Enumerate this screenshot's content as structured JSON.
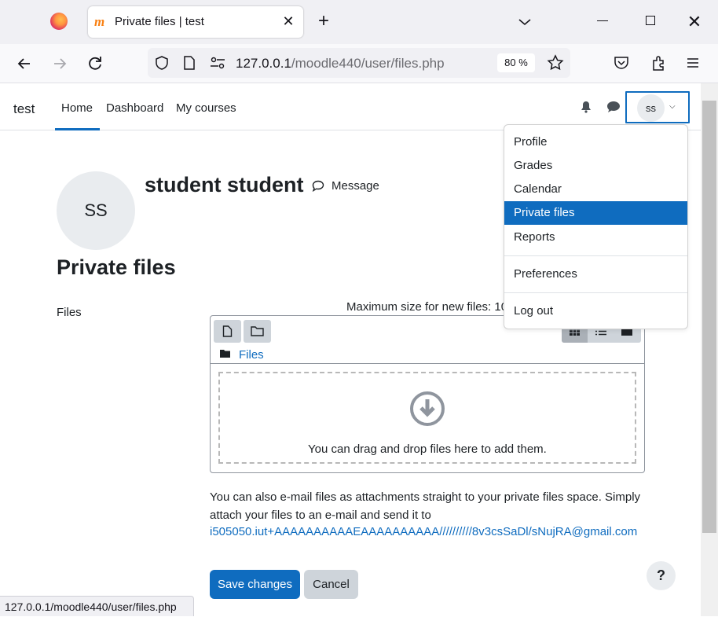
{
  "browser": {
    "tab_title": "Private files | test",
    "url_host": "127.0.0.1",
    "url_path": "/moodle440/user/files.php",
    "zoom": "80 %",
    "status_url": "127.0.0.1/moodle440/user/files.php"
  },
  "site": {
    "name": "test",
    "nav": [
      "Home",
      "Dashboard",
      "My courses"
    ],
    "active_nav": "Home",
    "user_initials": "ss"
  },
  "user_menu": {
    "items": [
      "Profile",
      "Grades",
      "Calendar",
      "Private files",
      "Reports"
    ],
    "active_item": "Private files",
    "preferences": "Preferences",
    "logout": "Log out"
  },
  "profile": {
    "initials": "SS",
    "name": "student student",
    "message_label": "Message"
  },
  "main": {
    "title": "Private files",
    "files_label": "Files",
    "max_size": "Maximum size for new files: 10",
    "breadcrumb": "Files",
    "drop_text": "You can drag and drop files here to add them.",
    "email_text": "You can also e-mail files as attachments straight to your private files space. Simply attach your files to an e-mail and send it to",
    "email_address": "i505050.iut+AAAAAAAAAAEAAAAAAAAAA//////////8v3csSaDl/sNujRA@gmail.com",
    "save_label": "Save changes",
    "cancel_label": "Cancel",
    "help_label": "?"
  },
  "colors": {
    "accent": "#0f6cbf",
    "button_secondary": "#ced4da"
  },
  "icons": [
    "firefox-icon",
    "moodle-icon",
    "close-icon",
    "plus-icon",
    "chevron-down-icon",
    "back-icon",
    "forward-icon",
    "reload-icon",
    "shield-icon",
    "page-icon",
    "permissions-icon",
    "star-icon",
    "pocket-icon",
    "extensions-icon",
    "menu-icon",
    "bell-icon",
    "chat-icon",
    "message-icon",
    "file-icon",
    "folder-icon",
    "grid-icon",
    "list-icon",
    "tree-icon",
    "download-icon"
  ]
}
